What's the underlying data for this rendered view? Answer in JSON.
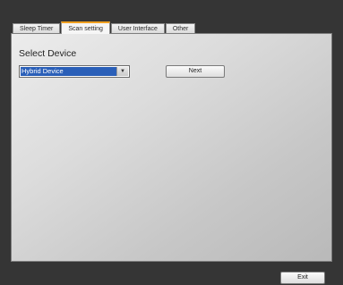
{
  "tabs": [
    {
      "label": "Sleep Timer",
      "active": false
    },
    {
      "label": "Scan setting",
      "active": true
    },
    {
      "label": "User Interface",
      "active": false
    },
    {
      "label": "Other",
      "active": false
    }
  ],
  "panel": {
    "select_label": "Select Device",
    "device_value": "Hybrid Device",
    "next_label": "Next"
  },
  "footer": {
    "exit_label": "Exit"
  },
  "colors": {
    "accent_tab": "#f0a020",
    "selection": "#2a5fb8"
  }
}
